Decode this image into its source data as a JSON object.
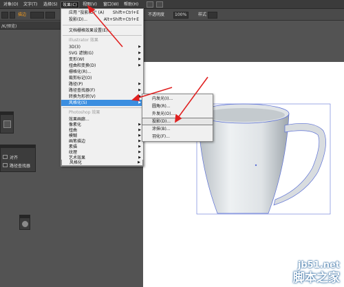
{
  "menubar": {
    "items": [
      "对象(O)",
      "文字(T)",
      "选择(S)",
      "效果(C)",
      "视图(V)",
      "窗口(W)",
      "帮助(H)"
    ]
  },
  "controlbar": {
    "fill_label": "描边",
    "opacity_label": "不透明度",
    "opacity_value": "100%",
    "style_label": "样式"
  },
  "doc_tab": {
    "title": "/K/预览)"
  },
  "effect_menu": {
    "top_items": [
      {
        "label": "应用 \"投影(D)\" (A)",
        "shortcut": "Shift+Ctrl+E"
      },
      {
        "label": "投影(D)...",
        "shortcut": "Alt+Shift+Ctrl+E"
      }
    ],
    "doc_raster": "文档栅格效果设置(E)...",
    "illustrator_header": "Illustrator 效果",
    "illustrator_items": [
      {
        "label": "3D(3)",
        "arrow": true
      },
      {
        "label": "SVG 滤镜(G)",
        "arrow": true
      },
      {
        "label": "变形(W)",
        "arrow": true
      },
      {
        "label": "扭曲和变换(D)",
        "arrow": true
      },
      {
        "label": "栅格化(R)...",
        "arrow": false
      },
      {
        "label": "裁剪标记(O)",
        "arrow": false
      },
      {
        "label": "路径(P)",
        "arrow": true
      },
      {
        "label": "路径查找器(F)",
        "arrow": true
      },
      {
        "label": "转换为形状(V)",
        "arrow": true
      },
      {
        "label": "风格化(S)",
        "arrow": true
      }
    ],
    "photoshop_header": "Photoshop 效果",
    "photoshop_items": [
      {
        "label": "效果画廊...",
        "arrow": false
      },
      {
        "label": "像素化",
        "arrow": true
      },
      {
        "label": "扭曲",
        "arrow": true
      },
      {
        "label": "模糊",
        "arrow": true
      },
      {
        "label": "画笔描边",
        "arrow": true
      },
      {
        "label": "素描",
        "arrow": true
      },
      {
        "label": "纹理",
        "arrow": true
      },
      {
        "label": "艺术效果",
        "arrow": true
      },
      {
        "label": "视频",
        "arrow": true
      },
      {
        "label": "风格化",
        "arrow": true
      }
    ]
  },
  "stylize_submenu": {
    "items": [
      "内发光(I)...",
      "圆角(R)...",
      "外发光(O)...",
      "投影(D)...",
      "涂抹(B)...",
      "羽化(F)..."
    ]
  },
  "layers_panel": {
    "items": [
      "对齐",
      "路径查找器"
    ]
  },
  "watermark": {
    "site": "jb51.net",
    "name": "脚本之家"
  },
  "colors": {
    "highlight": "#3b8ee0",
    "arrow_red": "#e02020",
    "ui_dark": "#535353"
  }
}
